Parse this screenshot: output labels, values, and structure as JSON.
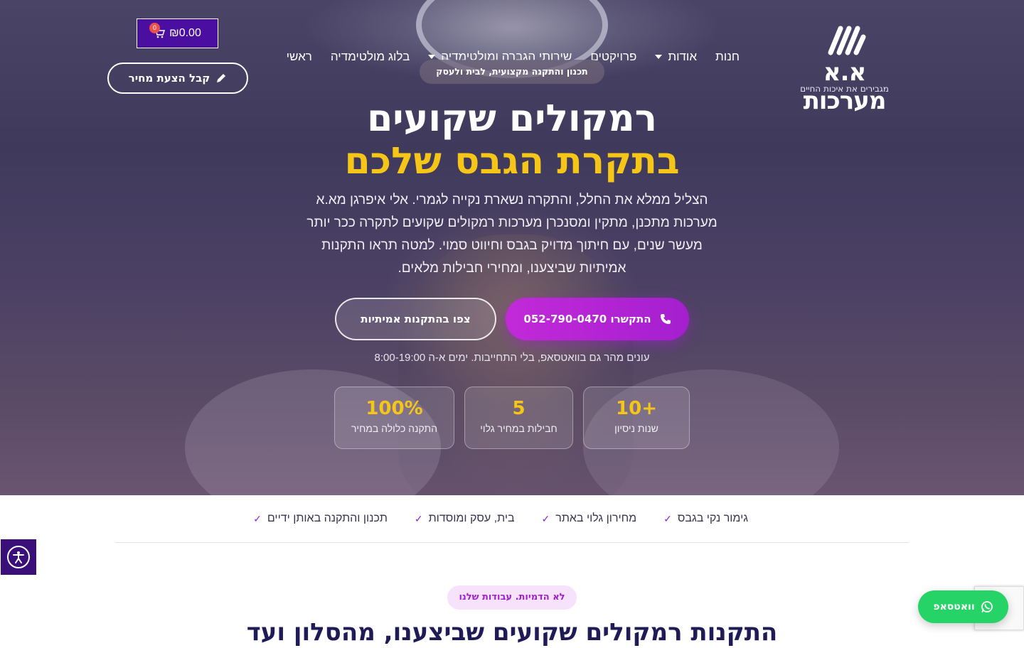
{
  "header": {
    "logo_text": "א.א מערכות",
    "logo_tagline": "מגבירים את איכות החיים",
    "nav": [
      {
        "label": "ראשי",
        "dropdown": false
      },
      {
        "label": "בלוג מולטימדיה",
        "dropdown": false
      },
      {
        "label": "שירותי הגברה ומולטימדיה",
        "dropdown": true
      },
      {
        "label": "פרויקטים",
        "dropdown": false
      },
      {
        "label": "אודות",
        "dropdown": true
      },
      {
        "label": "חנות",
        "dropdown": false
      }
    ],
    "cart_amount": "₪0.00",
    "cart_count": "0",
    "quote_button": "קבל הצעת מחיר"
  },
  "hero": {
    "pill": "תכנון והתקנה מקצועית, לבית ולעסק",
    "title_line1": "רמקולים שקועים",
    "title_line2": "בתקרת הגבס שלכם",
    "lead": "הצליל ממלא את החלל, והתקרה נשארת נקייה לגמרי. אלי איפרגן מא.א מערכות מתכנן, מתקין ומסנכרן מערכות רמקולים שקועים לתקרה ככר יותר מעשר שנים, עם חיתוך מדויק בגבס וחיווט סמוי. למטה תראו התקנות אמיתיות שביצענו, ומחירי חבילות מלאים.",
    "cta_call": "התקשרו 052-790-0470",
    "cta_view": "צפו בהתקנות אמיתיות",
    "note": "עונים מהר גם בוואטסאפ, בלי התחייבות. ימים א-ה 8:00-19:00",
    "stats": [
      {
        "value": "10+",
        "label": "שנות ניסיון"
      },
      {
        "value": "5",
        "label": "חבילות במחיר גלוי"
      },
      {
        "value": "100%",
        "label": "התקנה כלולה במחיר"
      }
    ]
  },
  "features": [
    "תכנון והתקנה באותן ידיים",
    "בית, עסק ומוסדות",
    "מחירון גלוי באתר",
    "גימור נקי בגבס"
  ],
  "section": {
    "pill": "לא הדמיות. עבודות שלנו",
    "title": "התקנות רמקולים שקועים שביצענו, מהסלון ועד"
  },
  "whatsapp_label": "וואטסאפ",
  "colors": {
    "accent_purple": "#a51fcf",
    "brand_yellow": "#f5c518",
    "cart_purple": "#4a0fa0",
    "whatsapp_green": "#25d366",
    "navy_title": "#1f1b56"
  },
  "icons": {
    "cart": "cart-icon",
    "pencil": "pencil-icon",
    "phone": "phone-icon",
    "check": "check-icon",
    "accessibility": "accessibility-icon",
    "whatsapp": "whatsapp-icon"
  }
}
